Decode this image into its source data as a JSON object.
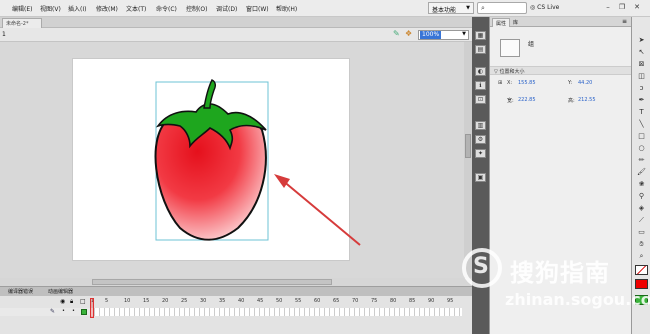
{
  "menu": [
    "编辑(E)",
    "视图(V)",
    "插入(I)",
    "修改(M)",
    "文本(T)",
    "命令(C)",
    "控制(O)",
    "调试(D)",
    "窗口(W)",
    "帮助(H)"
  ],
  "workspace": "基本功能",
  "cslive": "CS Live",
  "doc_tab": "未命名-2*",
  "zoom": "100%",
  "ruler_mark": "1",
  "timeline": {
    "tabs": [
      "编译器错误",
      "动画编辑器"
    ],
    "frame_numbers": [
      "1",
      "5",
      "10",
      "15",
      "20",
      "25",
      "30",
      "35",
      "40",
      "45",
      "50",
      "55",
      "60",
      "65",
      "70",
      "75",
      "80",
      "85",
      "90",
      "95"
    ]
  },
  "properties": {
    "tabs": [
      "属性",
      "库"
    ],
    "symbol_name": "组",
    "section": "位置和大小",
    "x_label": "X:",
    "x_value": "155.85",
    "y_label": "Y:",
    "y_value": "44.20",
    "w_label": "宽:",
    "w_value": "222.85",
    "h_label": "高:",
    "h_value": "212.55"
  },
  "watermark": {
    "text": "搜狗指南",
    "url": "zhinan.sogou.com",
    "logo": "S"
  },
  "colors": {
    "strawberry_red": "#e8141f",
    "leaf_green": "#1ea61e",
    "selection": "#6cc3d4",
    "arrow": "#d63b3b"
  },
  "icons": {
    "midtools": [
      "layout-icon",
      "properties-icon",
      "color-icon",
      "info-icon",
      "transform-icon",
      "library-icon",
      "components-icon",
      "motion-icon",
      "code-icon"
    ],
    "tools": [
      "selection-icon",
      "subselect-icon",
      "free-transform-icon",
      "gradient-icon",
      "lasso-icon",
      "pen-icon",
      "text-icon",
      "line-icon",
      "rect-icon",
      "oval-icon",
      "pencil-icon",
      "brush-icon",
      "deco-icon",
      "bone-icon",
      "bucket-icon",
      "eyedropper-icon",
      "eraser-icon",
      "hand-icon",
      "zoom-icon",
      "stroke-color-icon",
      "fill-color-icon",
      "swap-icon"
    ]
  }
}
